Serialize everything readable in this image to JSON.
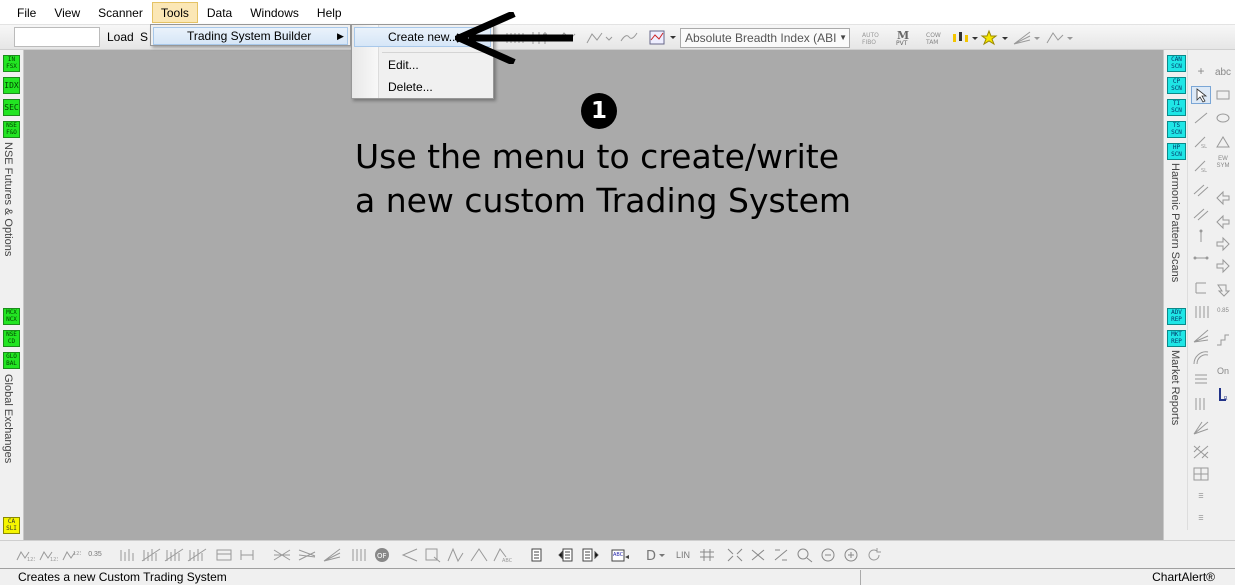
{
  "menubar": {
    "items": [
      "File",
      "View",
      "Scanner",
      "Tools",
      "Data",
      "Windows",
      "Help"
    ],
    "open_index": 3
  },
  "toolbar": {
    "symbol_value": "",
    "load_label": "Load",
    "s_label": "S",
    "index_select_value": "Absolute Breadth Index (ABI"
  },
  "tools_menu": {
    "item_label": "Trading System Builder"
  },
  "submenu": {
    "create_label": "Create new...",
    "edit_label": "Edit...",
    "delete_label": "Delete..."
  },
  "left_rail": {
    "group1_label": "NSE Futures & Options",
    "group1_buttons": [
      "IN FSX",
      "IDX",
      "SEC",
      "NSE F&O"
    ],
    "group2_label": "Global Exchanges",
    "group2_buttons": [
      "MCX NCX",
      "NSE CD",
      "GLO BAL"
    ],
    "bottom_button": "CA SLI"
  },
  "right_rail": {
    "group1_label": "Harmonic Pattern Scans",
    "group1_buttons": [
      "CAN SCN",
      "CP SCN",
      "TI SCN",
      "TS SCN",
      "HP SCN"
    ],
    "group2_label": "Market Reports",
    "group2_buttons": [
      "ADV REP",
      "MKT REP"
    ]
  },
  "chart": {
    "step_number": "1",
    "instruction_line1": "Use the menu to create/write",
    "instruction_line2": "a new custom Trading System"
  },
  "bottom_toolbar": {
    "lin_label": "LIN"
  },
  "statusbar": {
    "text": "Creates a new Custom Trading System",
    "right_text": "ChartAlert®"
  },
  "colors": {
    "chart_bg": "#aaaaaa",
    "menu_open_bg": "#fbe7b5",
    "rail_green": "#22e522",
    "rail_cyan": "#1fe6e6"
  }
}
